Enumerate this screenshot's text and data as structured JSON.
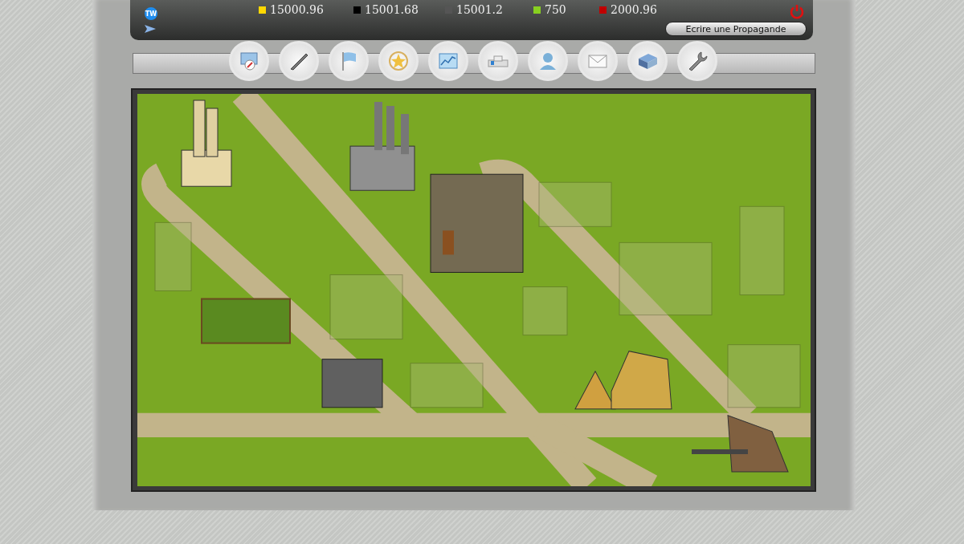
{
  "top_bar": {
    "logo": "TW",
    "resources": [
      {
        "amount": "15000.96",
        "color": "#ffd800"
      },
      {
        "amount": "15001.68",
        "color": "#000000"
      },
      {
        "amount": "15001.2",
        "color": "#555555"
      },
      {
        "amount": "750",
        "color": "#88d020"
      },
      {
        "amount": "2000.96",
        "color": "#c00000"
      }
    ],
    "propaganda_button": "Ecrire une Propagande"
  }
}
